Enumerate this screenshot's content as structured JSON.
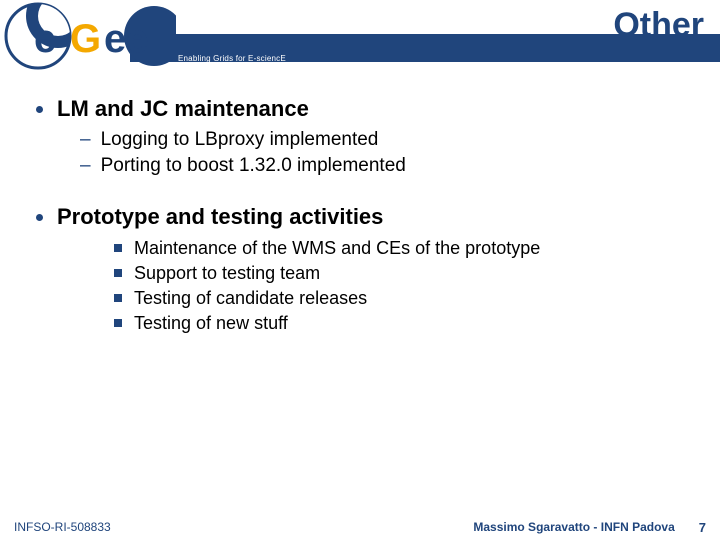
{
  "header": {
    "title": "Other",
    "tagline": "Enabling Grids for E-sciencE",
    "logo_text_e": "e",
    "logo_text_g": "G",
    "logo_text_ee": "ee"
  },
  "content": {
    "bullets": [
      {
        "heading": "LM and JC maintenance",
        "subitems": [
          "Logging to LBproxy implemented",
          "Porting to boost 1.32.0 implemented"
        ],
        "squares": []
      },
      {
        "heading": "Prototype and testing activities",
        "subitems": [],
        "squares": [
          "Maintenance of the WMS and CEs of the prototype",
          "Support to testing team",
          "Testing of candidate releases",
          "Testing of new stuff"
        ]
      }
    ]
  },
  "footer": {
    "left": "INFSO-RI-508833",
    "right": "Massimo Sgaravatto - INFN Padova",
    "page": "7"
  },
  "colors": {
    "brand_blue": "#20457c",
    "accent_yellow": "#f4a800"
  }
}
